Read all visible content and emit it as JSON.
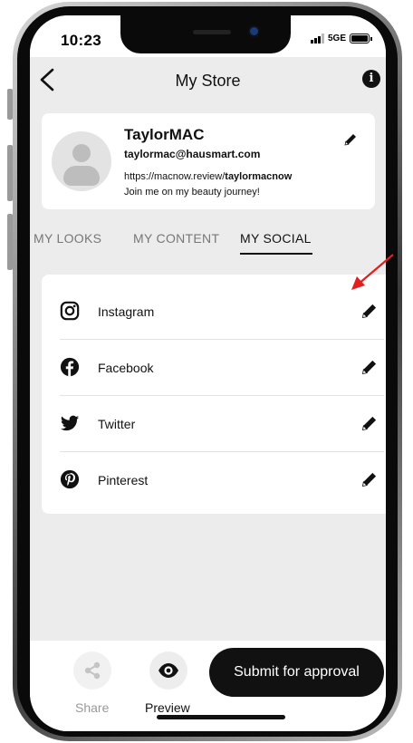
{
  "status_bar": {
    "time": "10:23",
    "network": "5GE"
  },
  "header": {
    "title": "My Store",
    "back_icon": "chevron-left-icon",
    "info_icon": "info-icon",
    "info_glyph": "i"
  },
  "profile": {
    "name": "TaylorMAC",
    "email": "taylormac@hausmart.com",
    "url_prefix": "https://macnow.review/",
    "url_handle": "taylormacnow",
    "bio": "Join me on my beauty journey!",
    "edit_icon": "pencil-icon"
  },
  "tabs": [
    {
      "label": "MY LOOKS",
      "active": false
    },
    {
      "label": "MY CONTENT",
      "active": false
    },
    {
      "label": "MY SOCIAL",
      "active": true
    }
  ],
  "social_links": [
    {
      "label": "Instagram",
      "icon": "instagram-icon"
    },
    {
      "label": "Facebook",
      "icon": "facebook-icon"
    },
    {
      "label": "Twitter",
      "icon": "twitter-icon"
    },
    {
      "label": "Pinterest",
      "icon": "pinterest-icon"
    }
  ],
  "annotation": {
    "icon": "red-arrow-icon",
    "color": "#e02020"
  },
  "bottom_bar": {
    "share_label": "Share",
    "preview_label": "Preview",
    "submit_label": "Submit for approval"
  }
}
